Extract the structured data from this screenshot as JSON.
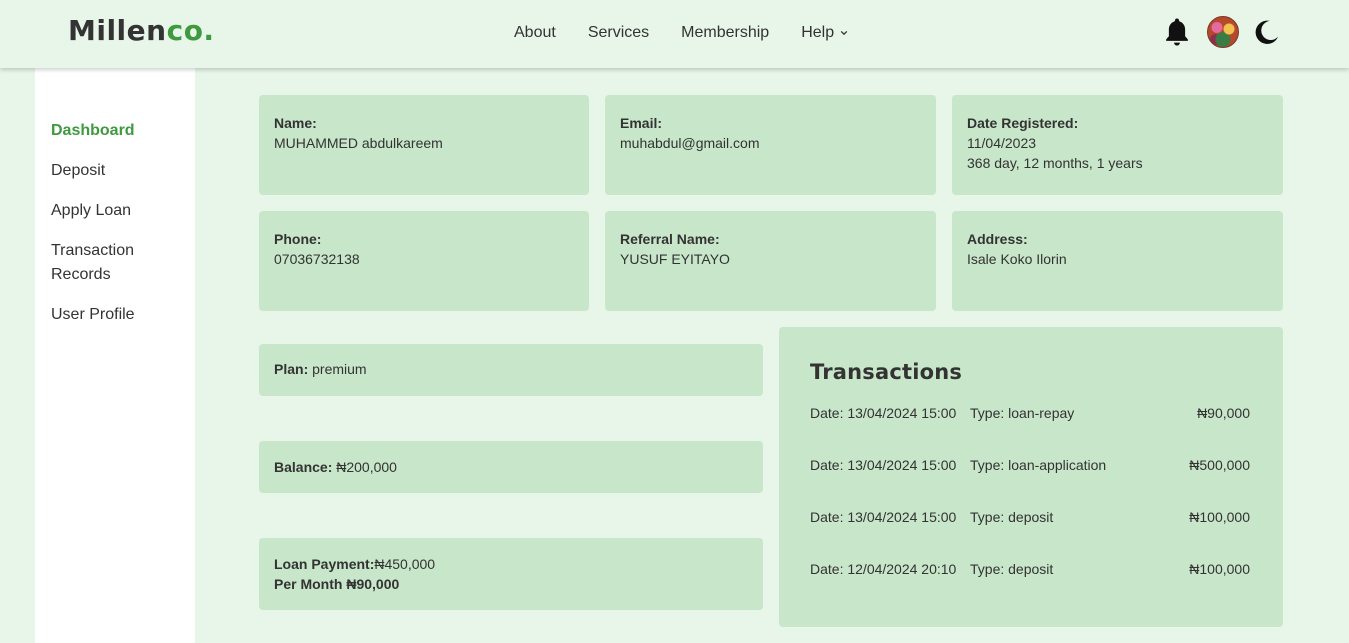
{
  "header": {
    "logo_main": "Millen",
    "logo_accent": "co.",
    "nav": [
      "About",
      "Services",
      "Membership",
      "Help"
    ],
    "icons": [
      "bell-icon",
      "avatar",
      "moon-icon"
    ]
  },
  "sidebar": {
    "items": [
      {
        "label": "Dashboard",
        "active": true
      },
      {
        "label": "Deposit"
      },
      {
        "label": "Apply Loan"
      },
      {
        "label": "Transaction Records"
      },
      {
        "label": "User Profile"
      }
    ]
  },
  "profile": {
    "name_label": "Name:",
    "name": "MUHAMMED abdulkareem",
    "email_label": "Email:",
    "email": "muhabdul@gmail.com",
    "date_label": "Date Registered:",
    "date": "11/04/2023",
    "duration": "368 day, 12 months, 1 years",
    "phone_label": "Phone:",
    "phone": "07036732138",
    "referral_label": "Referral Name:",
    "referral": "YUSUF EYITAYO",
    "address_label": "Address:",
    "address": "Isale Koko Ilorin"
  },
  "account": {
    "plan_label": "Plan:",
    "plan": "premium",
    "balance_label": "Balance:",
    "balance": "₦200,000",
    "loan_label": "Loan Payment:",
    "loan": "₦450,000",
    "per_month_label": "Per Month ₦90,000"
  },
  "transactions": {
    "title": "Transactions",
    "rows": [
      {
        "date": "Date: 13/04/2024 15:00",
        "type": "Type: loan-repay",
        "amount": "₦90,000"
      },
      {
        "date": "Date: 13/04/2024 15:00",
        "type": "Type: loan-application",
        "amount": "₦500,000"
      },
      {
        "date": "Date: 13/04/2024 15:00",
        "type": "Type: deposit",
        "amount": "₦100,000"
      },
      {
        "date": "Date: 12/04/2024 20:10",
        "type": "Type: deposit",
        "amount": "₦100,000"
      }
    ]
  },
  "colors": {
    "background": "#e8f5e9",
    "card": "#c8e6c9",
    "accent": "#3f9a3f",
    "sidebar": "#ffffff"
  }
}
